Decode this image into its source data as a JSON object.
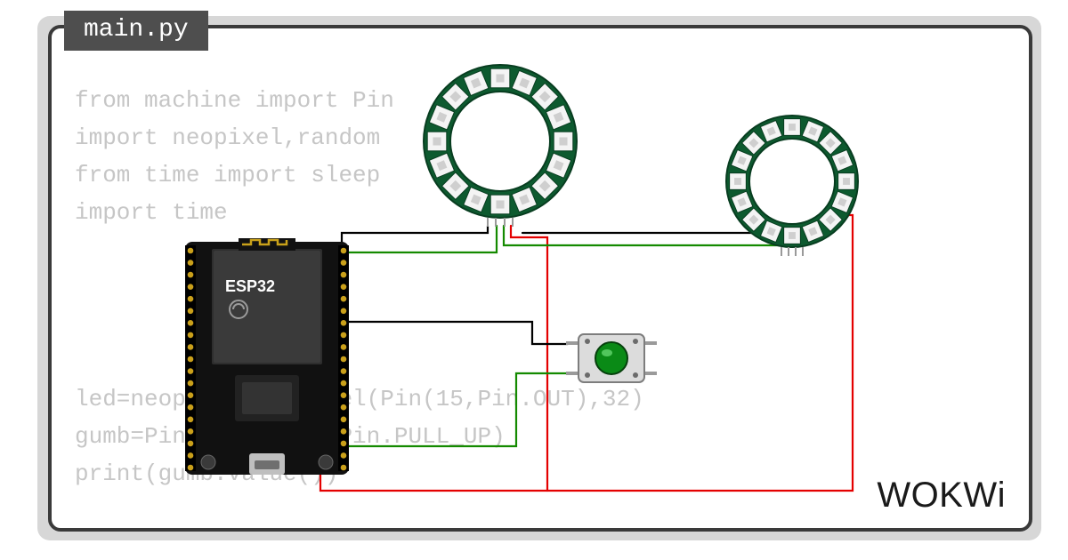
{
  "tab_label": "main.py",
  "brand": "WOKWi",
  "code_lines": [
    "from machine import Pin",
    "import neopixel,random",
    "from time import sleep",
    "import time",
    "",
    "",
    "",
    "",
    "led=neopixel.NeoPixel(Pin(15,Pin.OUT),32)",
    "gumb=Pin(25,Pin.IN,Pin.PULL_UP)",
    "print(gumb.value())"
  ],
  "components": {
    "mcu": {
      "label": "ESP32"
    },
    "ring_left": {
      "led_count": 16
    },
    "ring_right": {
      "led_count": 16
    },
    "pushbutton": {}
  },
  "wires": [
    {
      "from": "esp32-gnd-top",
      "to": "ring-left-gnd",
      "color": "#000000"
    },
    {
      "from": "esp32-d15",
      "to": "ring-left-din",
      "color": "#148a00"
    },
    {
      "from": "esp32-d25",
      "to": "button-left",
      "color": "#000000"
    },
    {
      "from": "esp32-gnd-bot",
      "to": "button-left2",
      "color": "#148a00"
    },
    {
      "from": "esp32-vin",
      "to": "ring-right-vcc",
      "color": "#e40000"
    },
    {
      "from": "ring-left-vcc",
      "to": "vin-rail",
      "color": "#e40000"
    },
    {
      "from": "ring-left-dout",
      "to": "ring-right-din",
      "color": "#148a00"
    },
    {
      "from": "ring-right-gnd",
      "to": "gnd-rail",
      "color": "#000000"
    }
  ]
}
